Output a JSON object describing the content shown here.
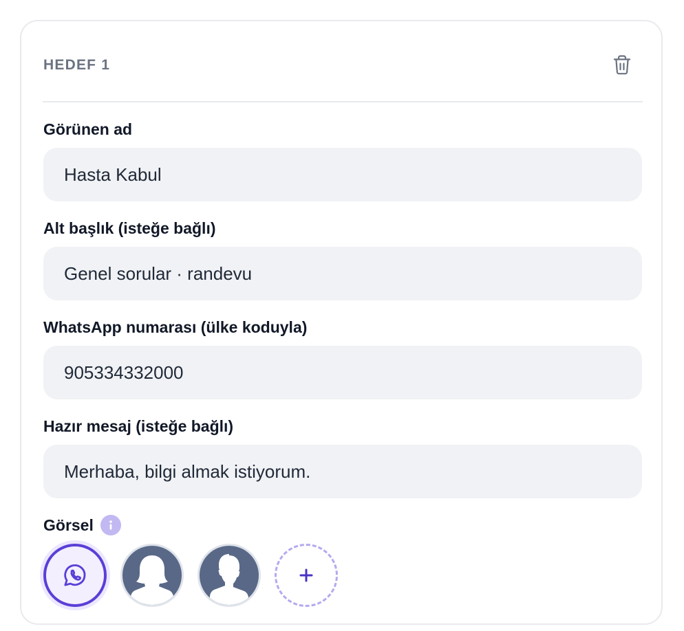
{
  "card": {
    "title": "HEDEF 1",
    "delete_icon": "trash-icon"
  },
  "fields": [
    {
      "label": "Görünen ad",
      "value": "Hasta Kabul"
    },
    {
      "label": "Alt başlık (isteğe bağlı)",
      "value": "Genel sorular · randevu"
    },
    {
      "label": "WhatsApp numarası (ülke koduyla)",
      "value": "905334332000"
    },
    {
      "label": "Hazır mesaj (isteğe bağlı)",
      "value": "Merhaba, bilgi almak istiyorum."
    }
  ],
  "image": {
    "label": "Görsel",
    "info_icon": "info-icon",
    "options": [
      {
        "icon": "whatsapp-icon",
        "selected": true
      },
      {
        "icon": "female-avatar-icon",
        "selected": false
      },
      {
        "icon": "male-avatar-icon",
        "selected": false
      },
      {
        "icon": "plus-icon",
        "selected": false
      }
    ]
  },
  "colors": {
    "accent": "#5b3fd6",
    "input_bg": "#f1f2f5",
    "muted_title": "#6b7280",
    "avatar_bg": "#596887"
  }
}
